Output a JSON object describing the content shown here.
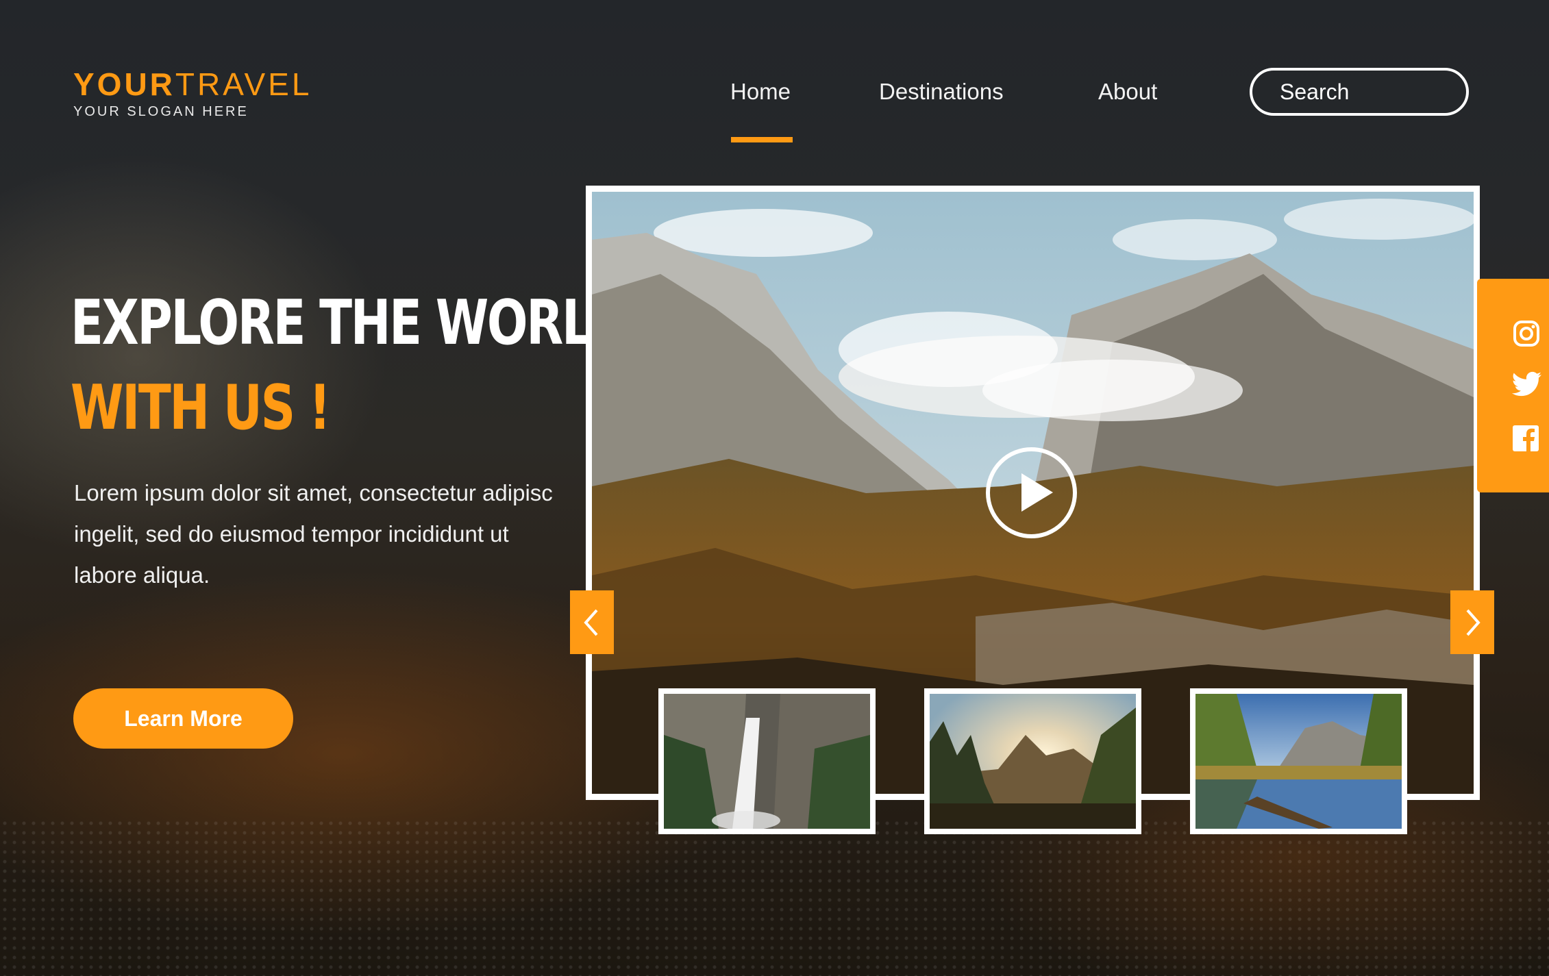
{
  "logo": {
    "brand_bold": "YOUR",
    "brand_light": "TRAVEL",
    "slogan": "YOUR SLOGAN HERE"
  },
  "nav": {
    "items": [
      {
        "label": "Home",
        "active": true
      },
      {
        "label": "Destinations",
        "active": false
      },
      {
        "label": "About",
        "active": false
      }
    ],
    "search_placeholder": "Search"
  },
  "hero": {
    "headline_line1": "EXPLORE THE WORLD",
    "headline_line2": "WITH US !",
    "description": "Lorem ipsum dolor sit amet, consectetur adipisc ingelit, sed do eiusmod tempor incididunt ut labore aliqua.",
    "cta_label": "Learn More"
  },
  "gallery": {
    "main_image": "mountain-valley-with-clouds",
    "thumbnails": [
      {
        "image": "waterfall-cliffs"
      },
      {
        "image": "sunset-over-forest"
      },
      {
        "image": "lake-reflection-valley"
      }
    ],
    "prev_icon": "chevron-left-icon",
    "next_icon": "chevron-right-icon",
    "play_icon": "play-icon"
  },
  "social": {
    "icons": [
      "instagram-icon",
      "twitter-icon",
      "facebook-icon"
    ]
  },
  "colors": {
    "accent": "#ff9a14",
    "background": "#1f2226",
    "text": "#ffffff"
  }
}
